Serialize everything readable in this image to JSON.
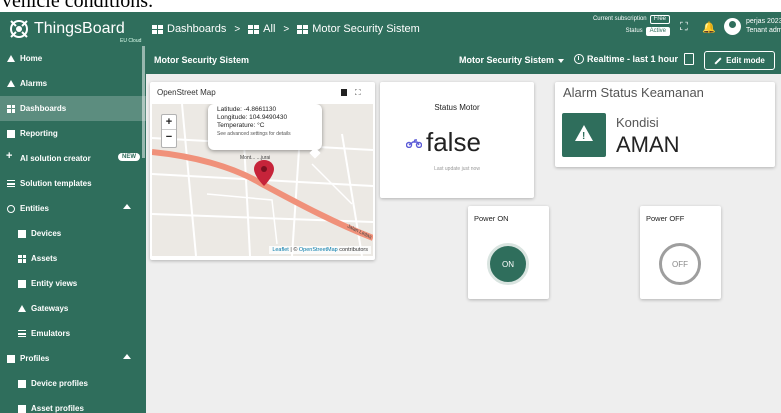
{
  "caption": "vehicle conditions.",
  "app": {
    "logo_text": "ThingsBoard",
    "logo_sub": "EU Cloud"
  },
  "breadcrumb": {
    "items": [
      "Dashboards",
      "All",
      "Motor Security Sistem"
    ],
    "separator": ">"
  },
  "subscription": {
    "label": "Current subscription",
    "plan": "Free",
    "status_label": "Status",
    "status": "Active"
  },
  "user": {
    "name": "perjas 2023",
    "role": "Tenant adm"
  },
  "sidebar": {
    "items": [
      {
        "label": "Home",
        "icon": "home-icon"
      },
      {
        "label": "Alarms",
        "icon": "warning-icon"
      },
      {
        "label": "Dashboards",
        "icon": "dashboards-icon"
      },
      {
        "label": "Reporting",
        "icon": "reporting-icon"
      },
      {
        "label": "AI solution creator",
        "icon": "sparkle-icon",
        "badge": "NEW"
      },
      {
        "label": "Solution templates",
        "icon": "menu-lines-icon"
      },
      {
        "label": "Entities",
        "icon": "entities-icon"
      },
      {
        "label": "Devices",
        "icon": "devices-icon"
      },
      {
        "label": "Assets",
        "icon": "assets-icon"
      },
      {
        "label": "Entity views",
        "icon": "entity-views-icon"
      },
      {
        "label": "Gateways",
        "icon": "gateways-icon"
      },
      {
        "label": "Emulators",
        "icon": "emulators-icon"
      },
      {
        "label": "Profiles",
        "icon": "profiles-icon"
      },
      {
        "label": "Device profiles",
        "icon": "device-profiles-icon"
      },
      {
        "label": "Asset profiles",
        "icon": "asset-profiles-icon"
      }
    ]
  },
  "dashboard": {
    "title": "Motor Security Sistem",
    "state": "Motor Security Sistem",
    "time_window": "Realtime - last 1 hour",
    "edit_label": "Edit mode"
  },
  "map_widget": {
    "title": "OpenStreet Map",
    "zoom_in": "+",
    "zoom_out": "−",
    "popup": {
      "latitude": "Latitude: -4.8661130",
      "longitude": "Longitude: 104.9490430",
      "temperature": "Temperature: °C",
      "note": "See advanced settings for details"
    },
    "town_label": "Mont... ...jurai",
    "road_label": "Jalan Lintas",
    "attribution": {
      "leaflet": "Leaflet",
      "sep": " | © ",
      "osm": "OpenStreetMap",
      "tail": " contributors"
    }
  },
  "status_widget": {
    "title": "Status Motor",
    "value": "false",
    "updated": "Last update just now",
    "icon": "motorcycle-icon"
  },
  "alarm_widget": {
    "title": "Alarm Status Keamanan",
    "label": "Kondisi",
    "value": "AMAN",
    "icon": "warning-icon"
  },
  "power_on": {
    "title": "Power ON",
    "button_label": "ON"
  },
  "power_off": {
    "title": "Power OFF",
    "button_label": "OFF"
  },
  "colors": {
    "primary": "#2f6e5c",
    "background": "#eeeeee",
    "route": "#f0917a",
    "marker": "#c6243a"
  }
}
